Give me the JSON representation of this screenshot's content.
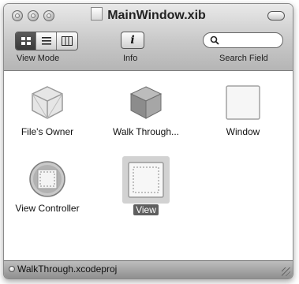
{
  "window": {
    "title": "MainWindow.xib"
  },
  "toolbar": {
    "view_mode_label": "View Mode",
    "info_label": "Info",
    "info_glyph": "i",
    "search_label": "Search Field",
    "search_value": "",
    "view_mode_selected": "icon-view"
  },
  "items": [
    {
      "label": "File's Owner",
      "icon": "cube-outline-icon",
      "selected": false
    },
    {
      "label": "Walk Through...",
      "icon": "cube-solid-icon",
      "selected": false
    },
    {
      "label": "Window",
      "icon": "window-icon",
      "selected": false
    },
    {
      "label": "View Controller",
      "icon": "view-controller-icon",
      "selected": false
    },
    {
      "label": "View",
      "icon": "view-icon",
      "selected": true
    }
  ],
  "status": {
    "project": "WalkThrough.xcodeproj"
  }
}
